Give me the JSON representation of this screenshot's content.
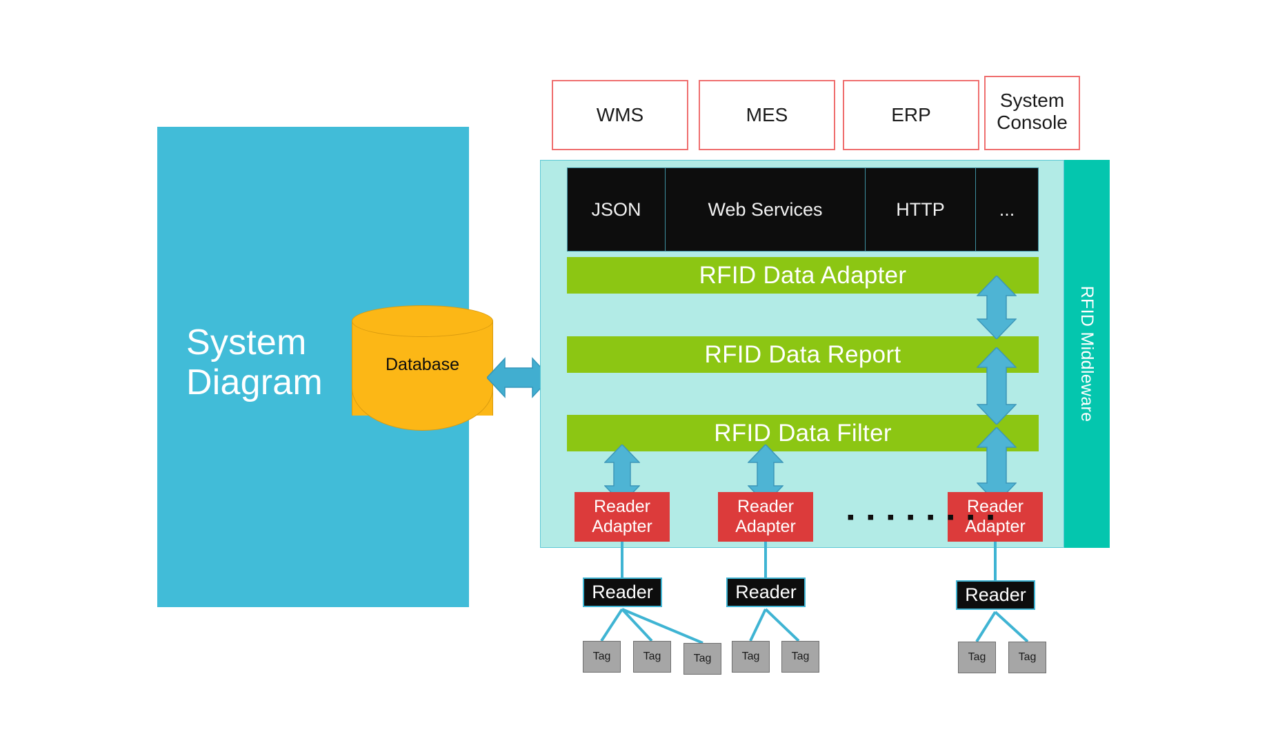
{
  "title": "RFID Middleware System Diagram",
  "colors": {
    "panel_blue": "#41bcd8",
    "database_orange": "#fcb716",
    "middleware_body": "#b2ebe6",
    "middleware_sidebar": "#04c6ae",
    "layer_green": "#8cc613",
    "adapter_red": "#dc3b3b",
    "app_box_border": "#ef6e6e",
    "protocol_black": "#0d0d0d",
    "tag_grey": "#a6a6a6",
    "arrow_blue": "#41aed0"
  },
  "left_panel": {
    "label_line1": "System",
    "label_line2": "Diagram"
  },
  "database": {
    "label": "Database"
  },
  "applications": [
    {
      "label": "WMS"
    },
    {
      "label": "MES"
    },
    {
      "label": "ERP"
    },
    {
      "label_line1": "System",
      "label_line2": "Console"
    }
  ],
  "middleware": {
    "sidebar_label": "RFID Middleware",
    "protocols": [
      {
        "label": "JSON"
      },
      {
        "label": "Web Services"
      },
      {
        "label": "HTTP"
      },
      {
        "label": "..."
      }
    ],
    "layers": [
      {
        "label": "RFID Data Adapter"
      },
      {
        "label": "RFID Data Report"
      },
      {
        "label": "RFID Data Filter"
      }
    ],
    "reader_adapters": [
      {
        "line1": "Reader",
        "line2": "Adapter"
      },
      {
        "line1": "Reader",
        "line2": "Adapter"
      },
      {
        "line1": "Reader",
        "line2": "Adapter"
      }
    ],
    "ellipsis": "▪ ▪ ▪ ▪ ▪ ▪ ▪ ▪"
  },
  "readers": [
    {
      "label": "Reader",
      "tags": [
        {
          "label": "Tag"
        },
        {
          "label": "Tag"
        },
        {
          "label": "Tag"
        }
      ]
    },
    {
      "label": "Reader",
      "tags": [
        {
          "label": "Tag"
        },
        {
          "label": "Tag"
        }
      ]
    },
    {
      "label": "Reader",
      "tags": [
        {
          "label": "Tag"
        },
        {
          "label": "Tag"
        }
      ]
    }
  ]
}
